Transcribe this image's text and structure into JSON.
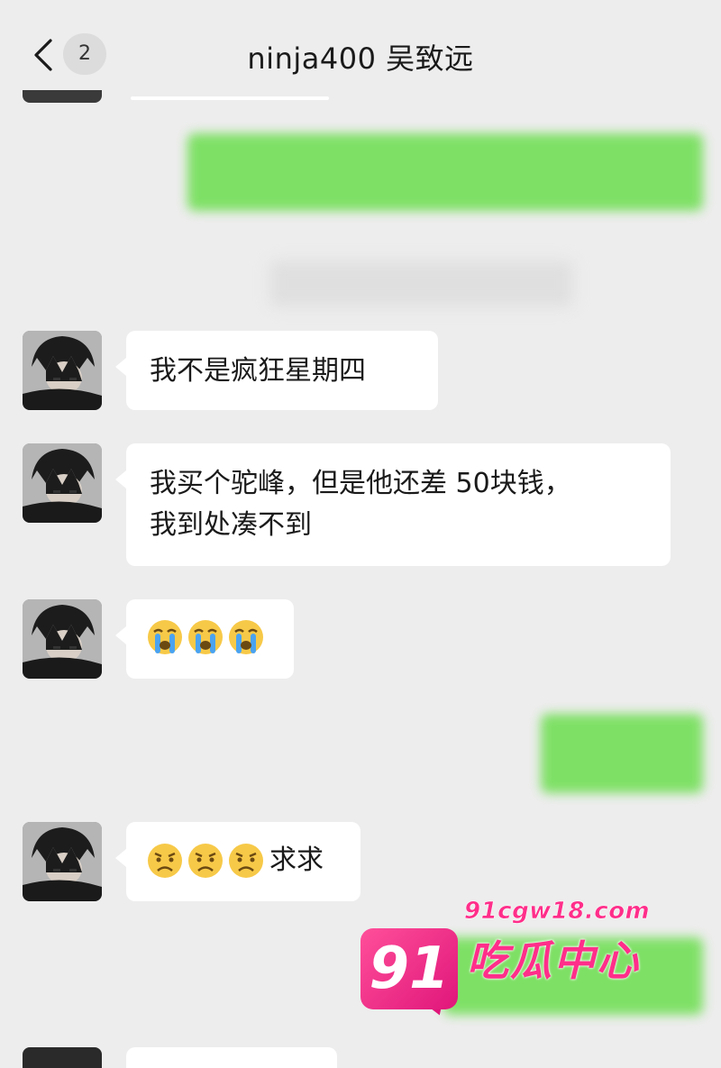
{
  "header": {
    "title": "ninja400 吴致远",
    "unread_count": "2",
    "back_icon": "chevron-left-icon"
  },
  "messages": [
    {
      "text": "我不是疯狂星期四"
    },
    {
      "line1": "我买个驼峰，但是他还差 50块钱，",
      "line2": "我到处凑不到"
    },
    {
      "emoji": "crying-face-icon",
      "count": 3
    },
    {
      "emoji": "frowning-face-icon",
      "count": 3,
      "text": "求求"
    }
  ],
  "watermark": {
    "badge": "91",
    "site": "91cgw18.com",
    "name": "吃瓜中心"
  },
  "colors": {
    "background": "#ededed",
    "incoming_bubble": "#ffffff",
    "outgoing_bubble": "#7ee065",
    "watermark": "#ff2e8a"
  }
}
